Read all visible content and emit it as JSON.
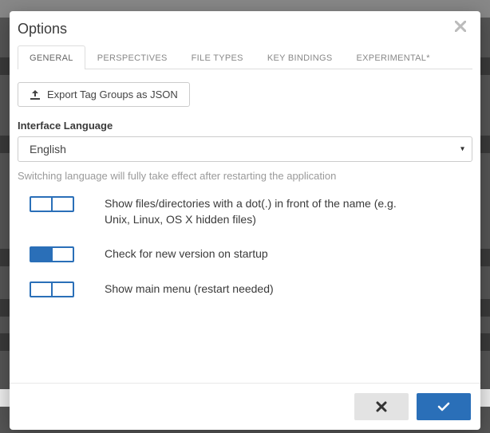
{
  "dialog": {
    "title": "Options"
  },
  "tabs": {
    "general": "GENERAL",
    "perspectives": "PERSPECTIVES",
    "filetypes": "FILE TYPES",
    "keybindings": "KEY BINDINGS",
    "experimental": "EXPERIMENTAL*"
  },
  "export_button": "Export Tag Groups as JSON",
  "lang": {
    "label": "Interface Language",
    "selected": "English",
    "hint": "Switching language will fully take effect after restarting the application"
  },
  "settings": {
    "show_hidden": {
      "label": "Show files/directories with a dot(.) in front of the name (e.g. Unix, Linux, OS X hidden files)",
      "on": false
    },
    "check_version": {
      "label": "Check for new version on startup",
      "on": true
    },
    "main_menu": {
      "label": "Show main menu (restart needed)",
      "on": false
    }
  }
}
